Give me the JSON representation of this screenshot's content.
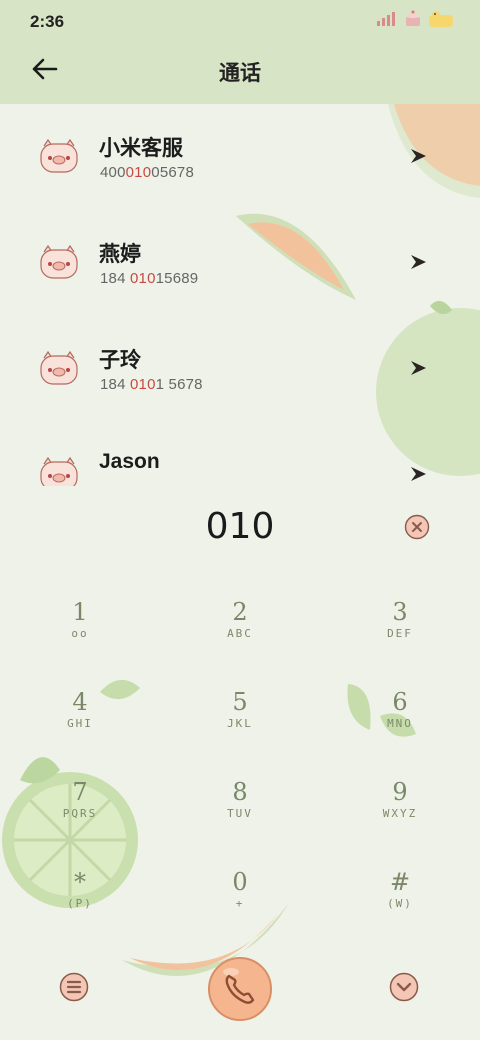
{
  "status_bar": {
    "time": "2:36"
  },
  "header": {
    "title": "通话",
    "back_icon": "arrow-left-icon"
  },
  "contacts": [
    {
      "name": "小米客服",
      "number_pre": "400",
      "number_match": "010",
      "number_post": "05678"
    },
    {
      "name": "燕婷",
      "number_pre": "184 ",
      "number_match": "010",
      "number_post": "15689"
    },
    {
      "name": "子玲",
      "number_pre": "184 ",
      "number_match": "010",
      "number_post": "1 5678"
    },
    {
      "name": "Jason",
      "number_pre": "",
      "number_match": "",
      "number_post": ""
    }
  ],
  "dialer": {
    "input": "010"
  },
  "keypad": [
    {
      "digit": "1",
      "letters": "oo"
    },
    {
      "digit": "2",
      "letters": "ABC"
    },
    {
      "digit": "3",
      "letters": "DEF"
    },
    {
      "digit": "4",
      "letters": "GHI"
    },
    {
      "digit": "5",
      "letters": "JKL"
    },
    {
      "digit": "6",
      "letters": "MNO"
    },
    {
      "digit": "7",
      "letters": "PQRS"
    },
    {
      "digit": "8",
      "letters": "TUV"
    },
    {
      "digit": "9",
      "letters": "WXYZ"
    },
    {
      "digit": "*",
      "letters": "(P)"
    },
    {
      "digit": "0",
      "letters": "+"
    },
    {
      "digit": "#",
      "letters": "(W)"
    }
  ],
  "colors": {
    "header_bg": "#d8e4c6",
    "page_bg": "#eef2e8",
    "highlight": "#c94a43",
    "call_button": "#f5b58e",
    "keypad_text": "#7c8a6a"
  }
}
